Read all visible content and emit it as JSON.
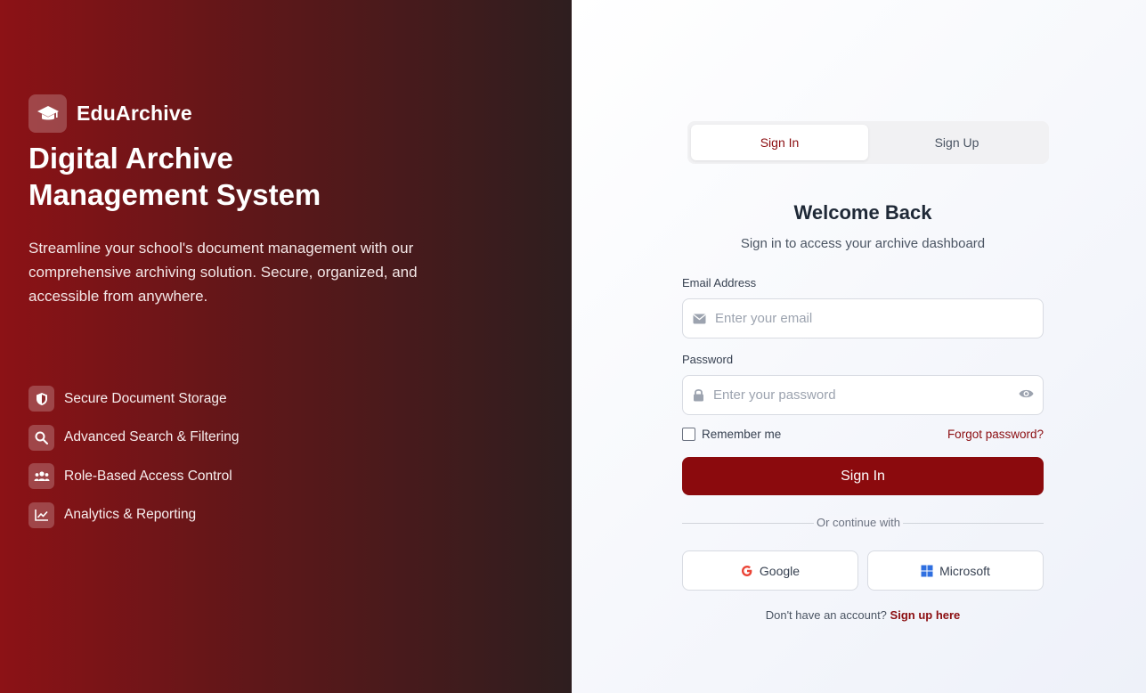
{
  "brand": {
    "name": "EduArchive",
    "icon": "graduation-cap-icon"
  },
  "hero": {
    "headline": "Digital Archive Management System",
    "description": "Streamline your school's document management with our comprehensive archiving solution. Secure, organized, and accessible from anywhere.",
    "features": [
      {
        "icon": "shield-icon",
        "label": "Secure Document Storage"
      },
      {
        "icon": "search-icon",
        "label": "Advanced Search & Filtering"
      },
      {
        "icon": "users-icon",
        "label": "Role-Based Access Control"
      },
      {
        "icon": "chart-line-icon",
        "label": "Analytics & Reporting"
      }
    ]
  },
  "auth": {
    "tabs": [
      {
        "label": "Sign In",
        "active": true
      },
      {
        "label": "Sign Up",
        "active": false
      }
    ],
    "title": "Welcome Back",
    "subtitle": "Sign in to access your archive dashboard",
    "email": {
      "label": "Email Address",
      "placeholder": "Enter your email",
      "value": ""
    },
    "password": {
      "label": "Password",
      "placeholder": "Enter your password",
      "value": ""
    },
    "remember_label": "Remember me",
    "remember_checked": false,
    "forgot_label": "Forgot password?",
    "submit_label": "Sign In",
    "divider_text": "Or continue with",
    "social": [
      {
        "icon": "google-icon",
        "label": "Google"
      },
      {
        "icon": "microsoft-icon",
        "label": "Microsoft"
      }
    ],
    "footer_text": "Don't have an account?",
    "footer_link": "Sign up here"
  },
  "colors": {
    "accent": "#8b0a0d",
    "gradient_start": "#8c1216",
    "gradient_end": "#2e1e1f"
  }
}
